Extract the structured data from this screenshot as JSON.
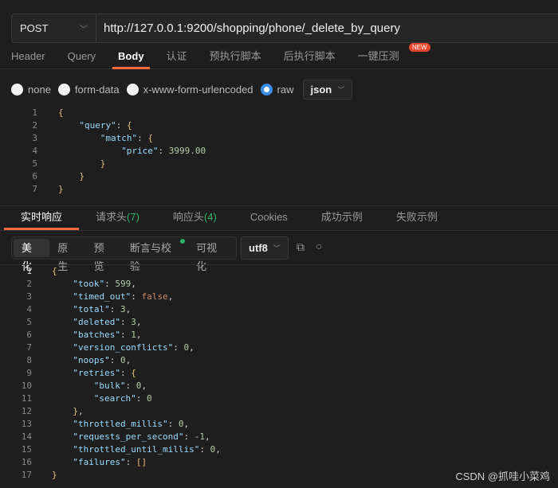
{
  "request": {
    "method": "POST",
    "url": "http://127.0.0.1:9200/shopping/phone/_delete_by_query",
    "tabs": [
      {
        "label": "Header"
      },
      {
        "label": "Query"
      },
      {
        "label": "Body",
        "active": true
      },
      {
        "label": "认证"
      },
      {
        "label": "预执行脚本"
      },
      {
        "label": "后执行脚本"
      },
      {
        "label": "一键压测"
      }
    ],
    "new_badge": "NEW",
    "body_types": [
      {
        "label": "none",
        "checked": false
      },
      {
        "label": "form-data",
        "checked": false
      },
      {
        "label": "x-www-form-urlencoded",
        "checked": false
      },
      {
        "label": "raw",
        "checked": true
      }
    ],
    "format": "json",
    "code": [
      {
        "i": 0,
        "t": [
          [
            "br",
            "{"
          ]
        ]
      },
      {
        "i": 1,
        "t": [
          [
            "k",
            "\"query\""
          ],
          [
            "p",
            ": "
          ],
          [
            "br",
            "{"
          ]
        ]
      },
      {
        "i": 2,
        "t": [
          [
            "k",
            "\"match\""
          ],
          [
            "p",
            ": "
          ],
          [
            "br",
            "{"
          ]
        ]
      },
      {
        "i": 3,
        "t": [
          [
            "k",
            "\"price\""
          ],
          [
            "p",
            ": "
          ],
          [
            "n",
            "3999.00"
          ]
        ]
      },
      {
        "i": 2,
        "t": [
          [
            "br",
            "}"
          ]
        ]
      },
      {
        "i": 1,
        "t": [
          [
            "br",
            "}"
          ]
        ]
      },
      {
        "i": 0,
        "t": [
          [
            "br",
            "}"
          ]
        ]
      }
    ]
  },
  "response": {
    "tabs": [
      {
        "label": "实时响应",
        "count": "",
        "active": true
      },
      {
        "label": "请求头",
        "count": "(7)"
      },
      {
        "label": "响应头",
        "count": "(4)"
      },
      {
        "label": "Cookies",
        "count": ""
      },
      {
        "label": "成功示例",
        "count": ""
      },
      {
        "label": "失败示例",
        "count": ""
      }
    ],
    "views": [
      {
        "label": "美化",
        "active": true
      },
      {
        "label": "原生"
      },
      {
        "label": "预览"
      },
      {
        "label": "断言与校验",
        "dot": true
      },
      {
        "label": "可视化"
      }
    ],
    "encoding": "utf8",
    "code": [
      {
        "i": 0,
        "t": [
          [
            "br",
            "{"
          ]
        ]
      },
      {
        "i": 1,
        "t": [
          [
            "k",
            "\"took\""
          ],
          [
            "p",
            ": "
          ],
          [
            "n",
            "599"
          ],
          [
            "p",
            ","
          ]
        ]
      },
      {
        "i": 1,
        "t": [
          [
            "k",
            "\"timed_out\""
          ],
          [
            "p",
            ": "
          ],
          [
            "b",
            "false"
          ],
          [
            "p",
            ","
          ]
        ]
      },
      {
        "i": 1,
        "t": [
          [
            "k",
            "\"total\""
          ],
          [
            "p",
            ": "
          ],
          [
            "n",
            "3"
          ],
          [
            "p",
            ","
          ]
        ]
      },
      {
        "i": 1,
        "t": [
          [
            "k",
            "\"deleted\""
          ],
          [
            "p",
            ": "
          ],
          [
            "n",
            "3"
          ],
          [
            "p",
            ","
          ]
        ]
      },
      {
        "i": 1,
        "t": [
          [
            "k",
            "\"batches\""
          ],
          [
            "p",
            ": "
          ],
          [
            "n",
            "1"
          ],
          [
            "p",
            ","
          ]
        ]
      },
      {
        "i": 1,
        "t": [
          [
            "k",
            "\"version_conflicts\""
          ],
          [
            "p",
            ": "
          ],
          [
            "n",
            "0"
          ],
          [
            "p",
            ","
          ]
        ]
      },
      {
        "i": 1,
        "t": [
          [
            "k",
            "\"noops\""
          ],
          [
            "p",
            ": "
          ],
          [
            "n",
            "0"
          ],
          [
            "p",
            ","
          ]
        ]
      },
      {
        "i": 1,
        "t": [
          [
            "k",
            "\"retries\""
          ],
          [
            "p",
            ": "
          ],
          [
            "br",
            "{"
          ]
        ]
      },
      {
        "i": 2,
        "t": [
          [
            "k",
            "\"bulk\""
          ],
          [
            "p",
            ": "
          ],
          [
            "n",
            "0"
          ],
          [
            "p",
            ","
          ]
        ]
      },
      {
        "i": 2,
        "t": [
          [
            "k",
            "\"search\""
          ],
          [
            "p",
            ": "
          ],
          [
            "n",
            "0"
          ]
        ]
      },
      {
        "i": 1,
        "t": [
          [
            "br",
            "}"
          ],
          [
            "p",
            ","
          ]
        ]
      },
      {
        "i": 1,
        "t": [
          [
            "k",
            "\"throttled_millis\""
          ],
          [
            "p",
            ": "
          ],
          [
            "n",
            "0"
          ],
          [
            "p",
            ","
          ]
        ]
      },
      {
        "i": 1,
        "t": [
          [
            "k",
            "\"requests_per_second\""
          ],
          [
            "p",
            ": "
          ],
          [
            "n",
            "-1"
          ],
          [
            "p",
            ","
          ]
        ]
      },
      {
        "i": 1,
        "t": [
          [
            "k",
            "\"throttled_until_millis\""
          ],
          [
            "p",
            ": "
          ],
          [
            "n",
            "0"
          ],
          [
            "p",
            ","
          ]
        ]
      },
      {
        "i": 1,
        "t": [
          [
            "k",
            "\"failures\""
          ],
          [
            "p",
            ": "
          ],
          [
            "br",
            "[]"
          ]
        ]
      },
      {
        "i": 0,
        "t": [
          [
            "br",
            "}"
          ]
        ]
      }
    ]
  },
  "watermark": "CSDN @抓哇小菜鸡",
  "colors": {
    "accent": "#ff6a3d",
    "radio": "#3a8ee6",
    "key": "#9cdcfe",
    "number": "#b5cea8",
    "boolean": "#ce8a68"
  }
}
